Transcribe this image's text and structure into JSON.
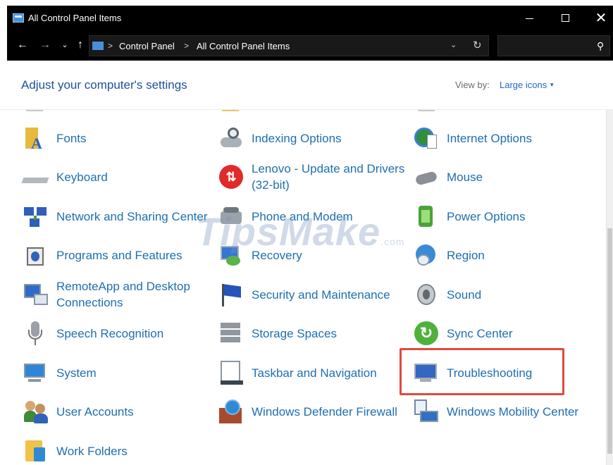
{
  "window": {
    "title": "All Control Panel Items",
    "controls": {
      "minimize": "—",
      "maximize": "☐",
      "close": "✕"
    }
  },
  "navigation": {
    "back": "←",
    "forward": "→",
    "recent": "⌄",
    "up": "↑",
    "breadcrumb": [
      "Control Panel",
      "All Control Panel Items"
    ],
    "separator": ">",
    "dropdown": "⌄",
    "refresh": "↻",
    "search_placeholder": "",
    "search_icon": "search-icon"
  },
  "header": {
    "heading": "Adjust your computer's settings",
    "view_by_label": "View by:",
    "view_by_value": "Large icons",
    "view_by_caret": "▼"
  },
  "items": [
    {
      "name": "fonts",
      "label": "Fonts",
      "icon": "fonts-icon"
    },
    {
      "name": "indexing-options",
      "label": "Indexing Options",
      "icon": "indexing-options-icon"
    },
    {
      "name": "internet-options",
      "label": "Internet Options",
      "icon": "internet-options-icon"
    },
    {
      "name": "keyboard",
      "label": "Keyboard",
      "icon": "keyboard-icon"
    },
    {
      "name": "lenovo-update",
      "label": "Lenovo - Update and Drivers (32-bit)",
      "icon": "lenovo-update-icon"
    },
    {
      "name": "mouse",
      "label": "Mouse",
      "icon": "mouse-icon"
    },
    {
      "name": "network-sharing",
      "label": "Network and Sharing Center",
      "icon": "network-icon"
    },
    {
      "name": "phone-modem",
      "label": "Phone and Modem",
      "icon": "phone-modem-icon"
    },
    {
      "name": "power-options",
      "label": "Power Options",
      "icon": "power-options-icon"
    },
    {
      "name": "programs-features",
      "label": "Programs and Features",
      "icon": "programs-features-icon"
    },
    {
      "name": "recovery",
      "label": "Recovery",
      "icon": "recovery-icon"
    },
    {
      "name": "region",
      "label": "Region",
      "icon": "region-icon"
    },
    {
      "name": "remoteapp",
      "label": "RemoteApp and Desktop Connections",
      "icon": "remoteapp-icon"
    },
    {
      "name": "security-maintenance",
      "label": "Security and Maintenance",
      "icon": "security-flag-icon"
    },
    {
      "name": "sound",
      "label": "Sound",
      "icon": "sound-icon"
    },
    {
      "name": "speech-recognition",
      "label": "Speech Recognition",
      "icon": "microphone-icon"
    },
    {
      "name": "storage-spaces",
      "label": "Storage Spaces",
      "icon": "storage-spaces-icon"
    },
    {
      "name": "sync-center",
      "label": "Sync Center",
      "icon": "sync-center-icon"
    },
    {
      "name": "system",
      "label": "System",
      "icon": "system-icon"
    },
    {
      "name": "taskbar-navigation",
      "label": "Taskbar and Navigation",
      "icon": "taskbar-icon"
    },
    {
      "name": "troubleshooting",
      "label": "Troubleshooting",
      "icon": "troubleshooting-icon"
    },
    {
      "name": "user-accounts",
      "label": "User Accounts",
      "icon": "user-accounts-icon"
    },
    {
      "name": "windows-defender-firewall",
      "label": "Windows Defender Firewall",
      "icon": "firewall-icon"
    },
    {
      "name": "windows-mobility-center",
      "label": "Windows Mobility Center",
      "icon": "mobility-center-icon"
    },
    {
      "name": "work-folders",
      "label": "Work Folders",
      "icon": "work-folders-icon"
    }
  ],
  "watermark": {
    "text": "TipsMake",
    "suffix": ".com"
  },
  "colors": {
    "link": "#1e6fb0",
    "heading": "#1e4f9c",
    "titlebar": "#000000",
    "highlight": "#e04a3c"
  }
}
